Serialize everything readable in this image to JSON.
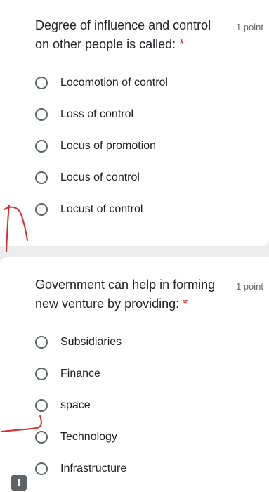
{
  "questions": [
    {
      "text": "Degree of influence and control on other people is called:",
      "required_mark": "*",
      "points": "1 point",
      "options": [
        "Locomotion of control",
        "Loss of control",
        "Locus of promotion",
        "Locus of control",
        "Locust of control"
      ]
    },
    {
      "text": "Government can help in forming new venture by providing:",
      "required_mark": "*",
      "points": "1 point",
      "options": [
        "Subsidiaries",
        "Finance",
        "space",
        "Technology",
        "Infrastructure"
      ]
    }
  ],
  "report_button": {
    "icon": "!"
  },
  "colors": {
    "required": "#d93025",
    "annotation": "#d32f2f",
    "radio_border": "#5f6368"
  }
}
